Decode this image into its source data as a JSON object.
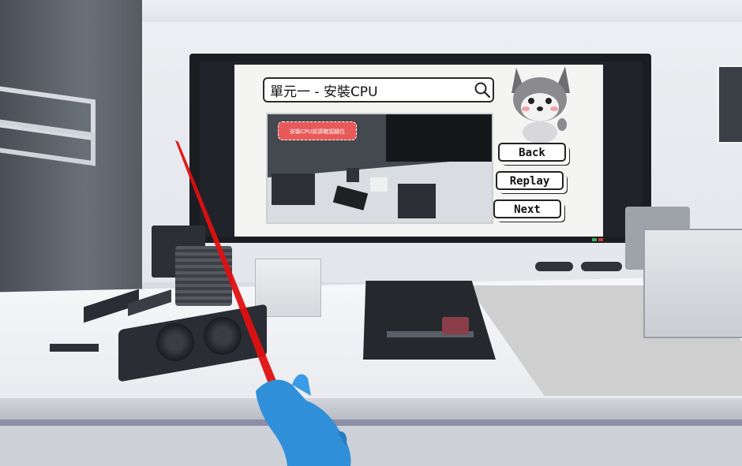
{
  "screen_panel": {
    "search_title": "單元一 - 安裝CPU",
    "hint_badge": "安裝CPU前請確認腳位",
    "buttons": {
      "back": "Back",
      "replay": "Replay",
      "next": "Next"
    }
  },
  "colors": {
    "laser": "#e01010",
    "hand": "#2f8fd8",
    "hint_badge": "#e85a5a"
  },
  "icons": [
    "search-icon",
    "husky-mascot",
    "vr-hand",
    "laser-pointer"
  ]
}
